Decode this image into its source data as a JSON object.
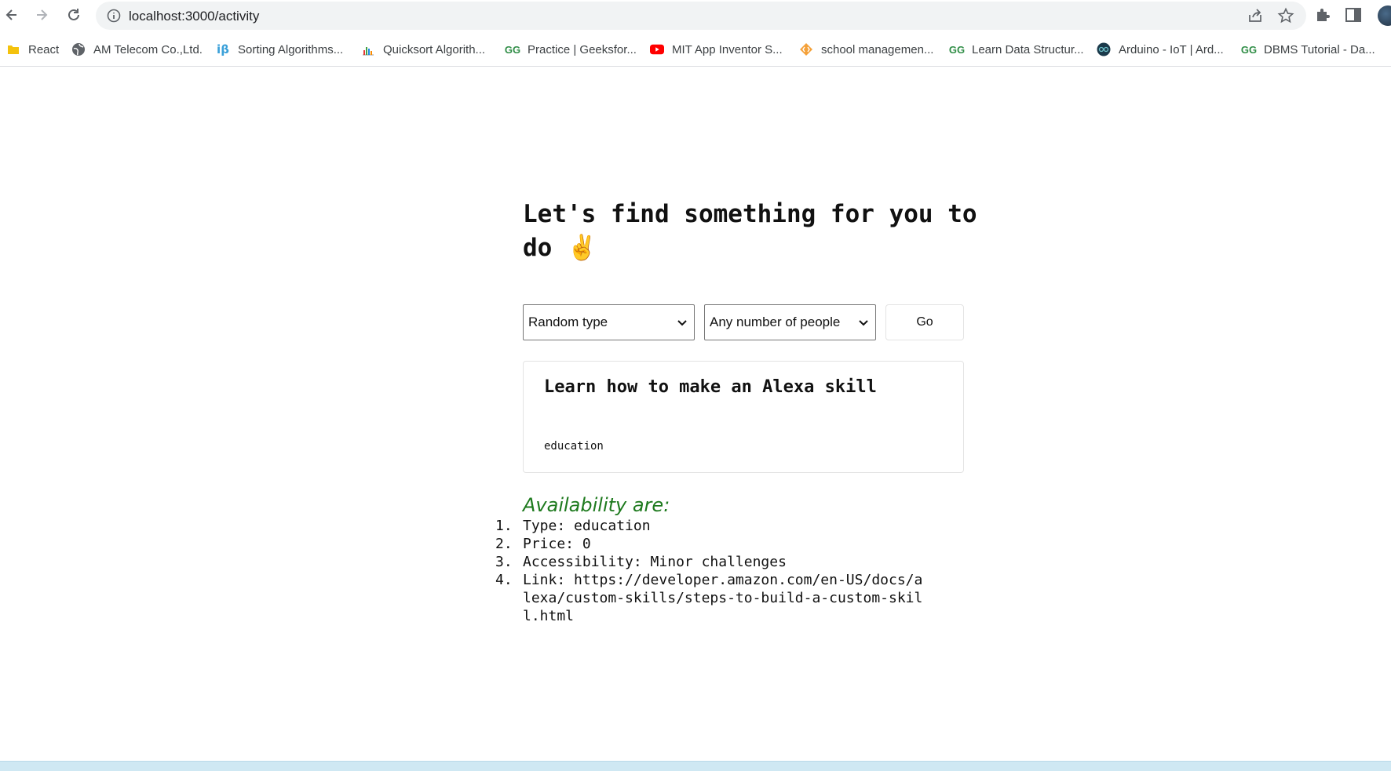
{
  "browser": {
    "url": "localhost:3000/activity",
    "bookmarks": [
      {
        "label": "React",
        "icon": "folder-icon"
      },
      {
        "label": "AM Telecom Co.,Ltd.",
        "icon": "globe-icon"
      },
      {
        "label": "Sorting Algorithms...",
        "icon": "ib-icon"
      },
      {
        "label": "Quicksort Algorith...",
        "icon": "bars-icon"
      },
      {
        "label": "Practice | Geeksfor...",
        "icon": "gfg-icon"
      },
      {
        "label": "MIT App Inventor S...",
        "icon": "youtube-icon"
      },
      {
        "label": "school managemen...",
        "icon": "code-icon"
      },
      {
        "label": "Learn Data Structur...",
        "icon": "gfg-icon"
      },
      {
        "label": "Arduino - IoT | Ard...",
        "icon": "arduino-icon"
      },
      {
        "label": "DBMS Tutorial - Da...",
        "icon": "gfg-icon"
      }
    ]
  },
  "page": {
    "heading": "Let's find something for you to do ✌️",
    "type_select": "Random type",
    "people_select": "Any number of people",
    "go_label": "Go",
    "activity": {
      "title": "Learn how to make an Alexa skill",
      "type": "education"
    },
    "availability_title": "Availability are:",
    "details": [
      {
        "num": "1.",
        "text": "Type: education"
      },
      {
        "num": "2.",
        "text": "Price: 0"
      },
      {
        "num": "3.",
        "text": "Accessibility: Minor challenges"
      },
      {
        "num": "4.",
        "text": "Link: https://developer.amazon.com/en-US/docs/alexa/custom-skills/steps-to-build-a-custom-skill.html"
      }
    ]
  },
  "colors": {
    "availability": "#1e7a1e",
    "omnibox": "#f1f3f4"
  }
}
